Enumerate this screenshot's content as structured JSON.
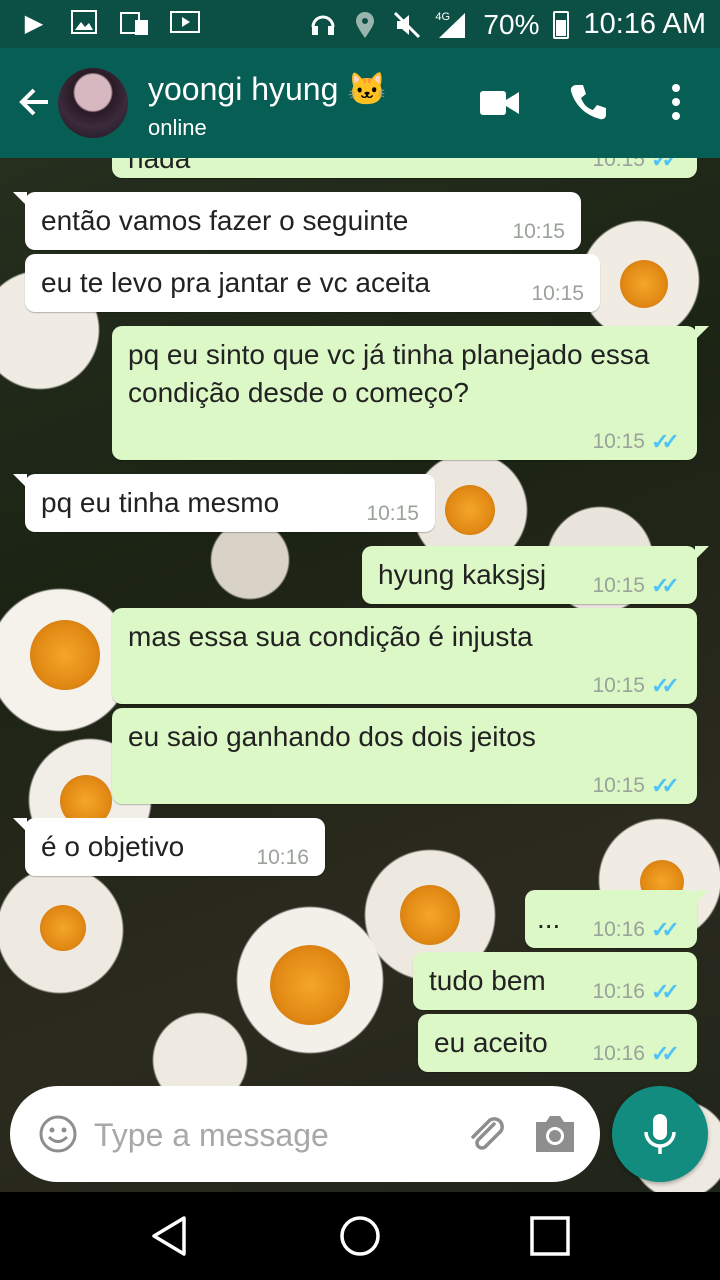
{
  "status_bar": {
    "battery": "70%",
    "time": "10:16 AM",
    "network": "4G"
  },
  "header": {
    "contact_name": "yoongi hyung 🐱",
    "contact_status": "online"
  },
  "messages": [
    {
      "direction": "out",
      "text": "nada",
      "time": "10:15",
      "ticks": "✓✓"
    },
    {
      "direction": "in",
      "text": "então vamos fazer o seguinte",
      "time": "10:15"
    },
    {
      "direction": "in",
      "text": "eu te levo pra jantar e vc aceita",
      "time": "10:15"
    },
    {
      "direction": "out",
      "text": "pq eu sinto que vc já tinha planejado essa condição desde o começo?",
      "time": "10:15",
      "ticks": "✓✓"
    },
    {
      "direction": "in",
      "text": "pq eu tinha mesmo",
      "time": "10:15"
    },
    {
      "direction": "out",
      "text": "hyung kaksjsj",
      "time": "10:15",
      "ticks": "✓✓"
    },
    {
      "direction": "out",
      "text": "mas essa sua condição é injusta",
      "time": "10:15",
      "ticks": "✓✓"
    },
    {
      "direction": "out",
      "text": "eu saio ganhando dos dois jeitos",
      "time": "10:15",
      "ticks": "✓✓"
    },
    {
      "direction": "in",
      "text": "é o objetivo",
      "time": "10:16"
    },
    {
      "direction": "out",
      "text": "...",
      "time": "10:16",
      "ticks": "✓✓"
    },
    {
      "direction": "out",
      "text": "tudo bem",
      "time": "10:16",
      "ticks": "✓✓"
    },
    {
      "direction": "out",
      "text": "eu aceito",
      "time": "10:16",
      "ticks": "✓✓"
    }
  ],
  "input": {
    "placeholder": "Type a message"
  },
  "colors": {
    "header": "#075e54",
    "status_bar": "#0b4f45",
    "outgoing_bubble": "#dcf8c6",
    "incoming_bubble": "#ffffff",
    "read_ticks": "#4fc3f7",
    "mic_button": "#128c7e"
  },
  "icons": {
    "status_left": [
      "play-icon",
      "image-icon",
      "sim-icon",
      "video-icon"
    ],
    "status_right": [
      "headset-icon",
      "location-icon",
      "mute-icon",
      "signal-icon",
      "battery-icon"
    ]
  }
}
